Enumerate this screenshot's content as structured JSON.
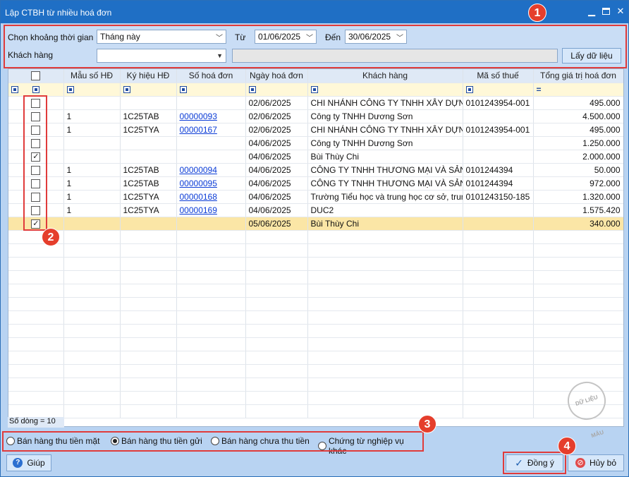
{
  "window": {
    "title": "Lập CTBH từ nhiều hoá đơn",
    "minimize_icon": "minimize-icon",
    "maximize_icon": "maximize-icon",
    "close_icon": "close-icon"
  },
  "callouts": [
    "1",
    "2",
    "3",
    "4"
  ],
  "filters": {
    "period_label": "Chọn khoảng thời gian",
    "period_value": "Tháng này",
    "from_label": "Từ",
    "from_value": "01/06/2025",
    "to_label": "Đến",
    "to_value": "30/06/2025",
    "customer_label": "Khách hàng",
    "customer_value": "",
    "customer_name_value": "",
    "fetch_button": "Lấy dữ liệu"
  },
  "table": {
    "columns": [
      "",
      "Mẫu số HĐ",
      "Ký hiệu HĐ",
      "Số hoá đơn",
      "Ngày hoá đơn",
      "Khách hàng",
      "Mã số thuế",
      "Tổng giá trị hoá đơn"
    ],
    "filter_row_last": "=",
    "rows": [
      {
        "checked": false,
        "mau": "",
        "kyhieu": "",
        "so": "",
        "ngay": "02/06/2025",
        "kh": "CHI NHÁNH CÔNG TY TNHH XÂY DỰN",
        "mst": "0101243954-001",
        "tong": "495.000"
      },
      {
        "checked": false,
        "mau": "1",
        "kyhieu": "1C25TAB",
        "so": "00000093",
        "ngay": "02/06/2025",
        "kh": "Công ty TNHH Dương Sơn",
        "mst": "",
        "tong": "4.500.000"
      },
      {
        "checked": false,
        "mau": "1",
        "kyhieu": "1C25TYA",
        "so": "00000167",
        "ngay": "02/06/2025",
        "kh": "CHI NHÁNH CÔNG TY TNHH XÂY DỰN",
        "mst": "0101243954-001",
        "tong": "495.000"
      },
      {
        "checked": false,
        "mau": "",
        "kyhieu": "",
        "so": "",
        "ngay": "04/06/2025",
        "kh": "Công ty TNHH Dương Sơn",
        "mst": "",
        "tong": "1.250.000"
      },
      {
        "checked": true,
        "mau": "",
        "kyhieu": "",
        "so": "",
        "ngay": "04/06/2025",
        "kh": "Bùi Thùy Chi",
        "mst": "",
        "tong": "2.000.000"
      },
      {
        "checked": false,
        "mau": "1",
        "kyhieu": "1C25TAB",
        "so": "00000094",
        "ngay": "04/06/2025",
        "kh": "CÔNG TY TNHH THƯƠNG MẠI VÀ SẢN",
        "mst": "0101244394",
        "tong": "50.000"
      },
      {
        "checked": false,
        "mau": "1",
        "kyhieu": "1C25TAB",
        "so": "00000095",
        "ngay": "04/06/2025",
        "kh": "CÔNG TY TNHH THƯƠNG MẠI VÀ SẢN",
        "mst": "0101244394",
        "tong": "972.000"
      },
      {
        "checked": false,
        "mau": "1",
        "kyhieu": "1C25TYA",
        "so": "00000168",
        "ngay": "04/06/2025",
        "kh": "Trường Tiểu học và trung học cơ sở, trung",
        "mst": "0101243150-185",
        "tong": "1.320.000"
      },
      {
        "checked": false,
        "mau": "1",
        "kyhieu": "1C25TYA",
        "so": "00000169",
        "ngay": "04/06/2025",
        "kh": "DUC2",
        "mst": "",
        "tong": "1.575.420"
      },
      {
        "checked": true,
        "mau": "",
        "kyhieu": "",
        "so": "",
        "ngay": "05/06/2025",
        "kh": "Bùi Thùy Chi",
        "mst": "",
        "tong": "340.000"
      }
    ],
    "row_count": "Số dòng = 10",
    "watermark": "DỮ LIỆU MẪU"
  },
  "payment_types": [
    {
      "label": "Bán hàng thu tiền mặt",
      "selected": false
    },
    {
      "label": "Bán hàng thu tiền gửi",
      "selected": true
    },
    {
      "label": "Bán hàng chưa thu tiền",
      "selected": false
    },
    {
      "label": "Chứng từ nghiệp vụ khác",
      "selected": false
    }
  ],
  "buttons": {
    "help": "Giúp",
    "ok": "Đồng ý",
    "cancel": "Hủy bỏ"
  },
  "colors": {
    "titlebar": "#1f6fc5",
    "window_bg": "#b8d3f2",
    "callout": "#e53e2c",
    "selected_row": "#fbe6a6",
    "link": "#0a3bd6"
  }
}
